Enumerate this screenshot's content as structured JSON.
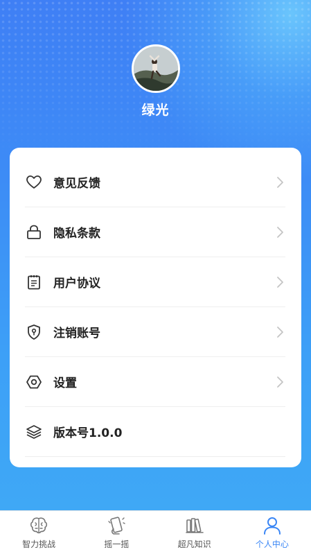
{
  "profile": {
    "username": "绿光"
  },
  "menu": {
    "items": [
      {
        "label": "意见反馈",
        "icon": "heart-icon"
      },
      {
        "label": "隐私条款",
        "icon": "lock-icon"
      },
      {
        "label": "用户协议",
        "icon": "notepad-icon"
      },
      {
        "label": "注销账号",
        "icon": "shield-key-icon"
      },
      {
        "label": "设置",
        "icon": "hexagon-settings-icon"
      },
      {
        "label": "版本号1.0.0",
        "icon": "layers-icon"
      }
    ]
  },
  "tabbar": {
    "tabs": [
      {
        "label": "智力挑战",
        "icon": "brain-icon",
        "active": false
      },
      {
        "label": "摇一摇",
        "icon": "shake-phone-icon",
        "active": false
      },
      {
        "label": "超凡知识",
        "icon": "books-icon",
        "active": false
      },
      {
        "label": "个人中心",
        "icon": "person-icon",
        "active": true
      }
    ]
  },
  "colors": {
    "accent": "#3a86f5",
    "header_gradient_top": "#3f7ff5",
    "header_gradient_bottom": "#3fa8f6"
  }
}
